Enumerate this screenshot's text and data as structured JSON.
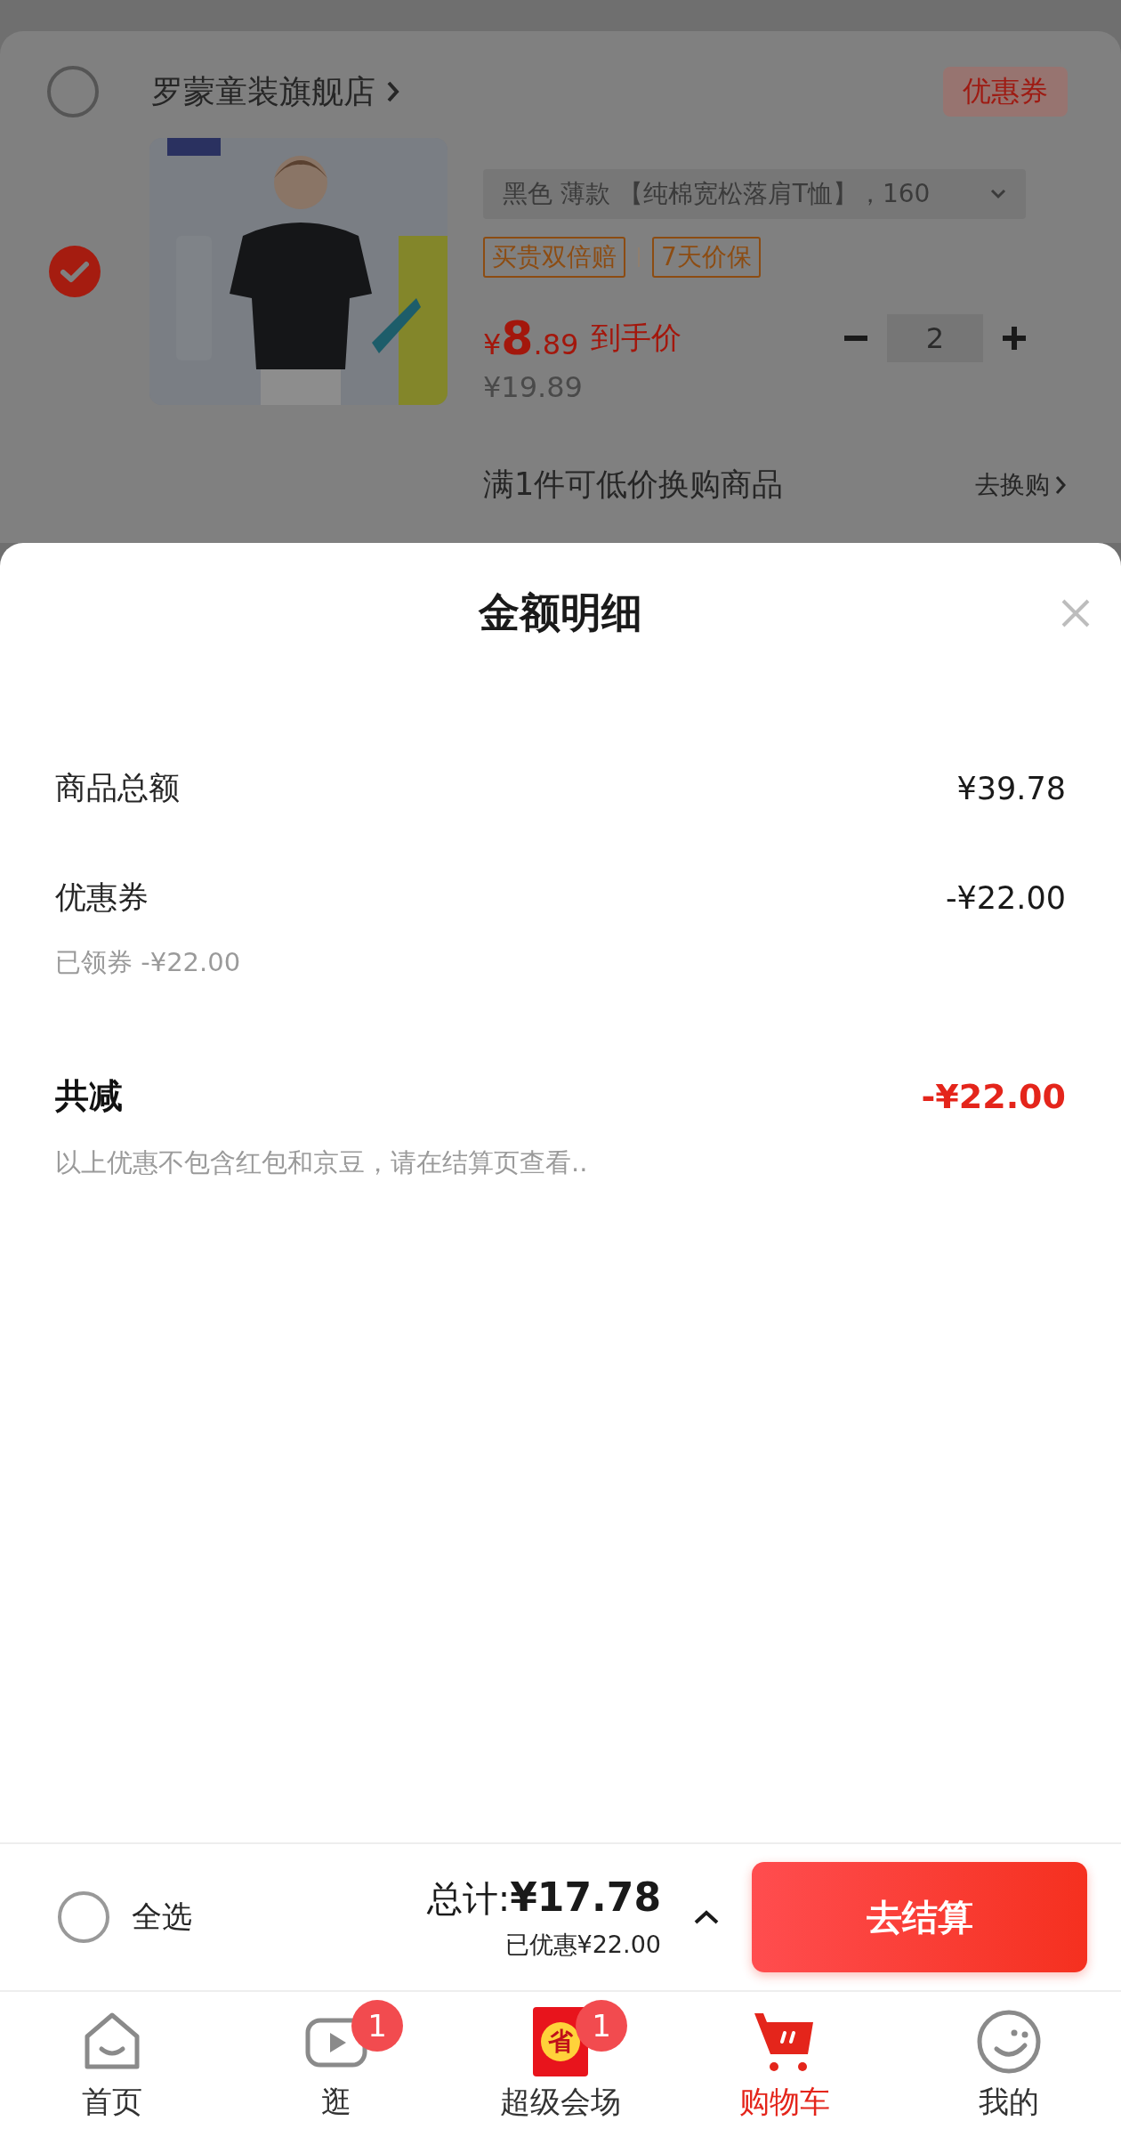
{
  "cart": {
    "store": {
      "checked": false,
      "name": "罗蒙童装旗舰店",
      "coupon_badge": "优惠券"
    },
    "item": {
      "checked": true,
      "image": {
        "kind": "picture"
      },
      "variant": "黑色 薄款 【纯棉宽松落肩T恤】，160",
      "tags": [
        "买贵双倍赔",
        "7天价保"
      ],
      "price_symbol": "¥",
      "price_integer": "8",
      "price_decimal": ".89",
      "price_label": "到手价",
      "quantity": "2",
      "original_price": "¥19.89"
    },
    "promo": {
      "text": "满1件可低价换购商品",
      "link": "去换购"
    }
  },
  "sheet": {
    "title": "金额明细",
    "rows": [
      {
        "kind": "normal",
        "label": "商品总额",
        "value": "¥39.78"
      },
      {
        "kind": "normal",
        "label": "优惠券",
        "value": "-¥22.00",
        "note": "已领券 -¥22.00"
      },
      {
        "kind": "total",
        "label": "共减",
        "value": "-¥22.00",
        "note": "以上优惠不包含红包和京豆，请在结算页查看.."
      }
    ]
  },
  "checkout": {
    "select_all": {
      "label": "全选",
      "checked": false
    },
    "total_label": "总计:",
    "total": "¥17.78",
    "saved": "已优惠¥22.00",
    "button": "去结算"
  },
  "tabs": [
    {
      "kind": "home",
      "label": "首页",
      "selected": false
    },
    {
      "kind": "video",
      "label": "逛",
      "badge": "1",
      "selected": false
    },
    {
      "kind": "packet",
      "label": "超级会场",
      "icon_text": "省",
      "badge": "1",
      "selected": false
    },
    {
      "kind": "cart",
      "label": "购物车",
      "selected": true
    },
    {
      "kind": "smile",
      "label": "我的",
      "selected": false
    }
  ]
}
